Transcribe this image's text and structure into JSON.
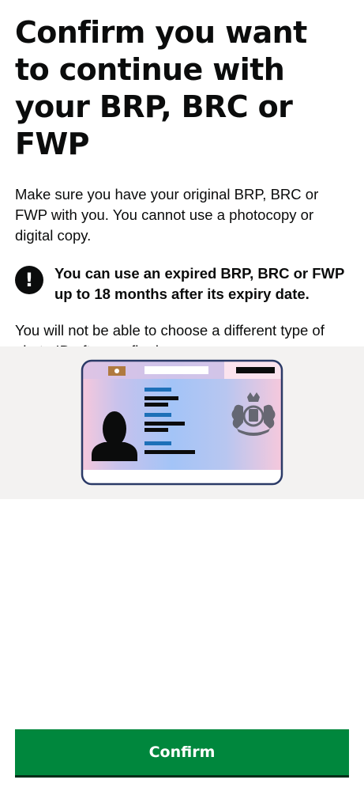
{
  "page": {
    "title": "Confirm you want to continue with your BRP, BRC or FWP",
    "intro": "Make sure you have your original BRP, BRC or FWP with you. You cannot use a photocopy or digital copy.",
    "warning": {
      "icon": "exclamation-icon",
      "symbol": "!",
      "text": "You can use an expired BRP, BRC or FWP up to 18 months after its expiry date."
    },
    "note": "You will not be able to choose a different type of photo ID after confirming."
  },
  "illustration": {
    "name": "residence-permit-card-illustration",
    "colors": {
      "panel_background": "#f3f2f1",
      "card_border": "#2b3a67",
      "gradient_pink": "#f6c8dc",
      "gradient_blue": "#a3c4f7"
    }
  },
  "actions": {
    "confirm_label": "Confirm"
  },
  "colors": {
    "text": "#0b0c0c",
    "button": "#00873d",
    "button_shadow": "#002d18"
  }
}
